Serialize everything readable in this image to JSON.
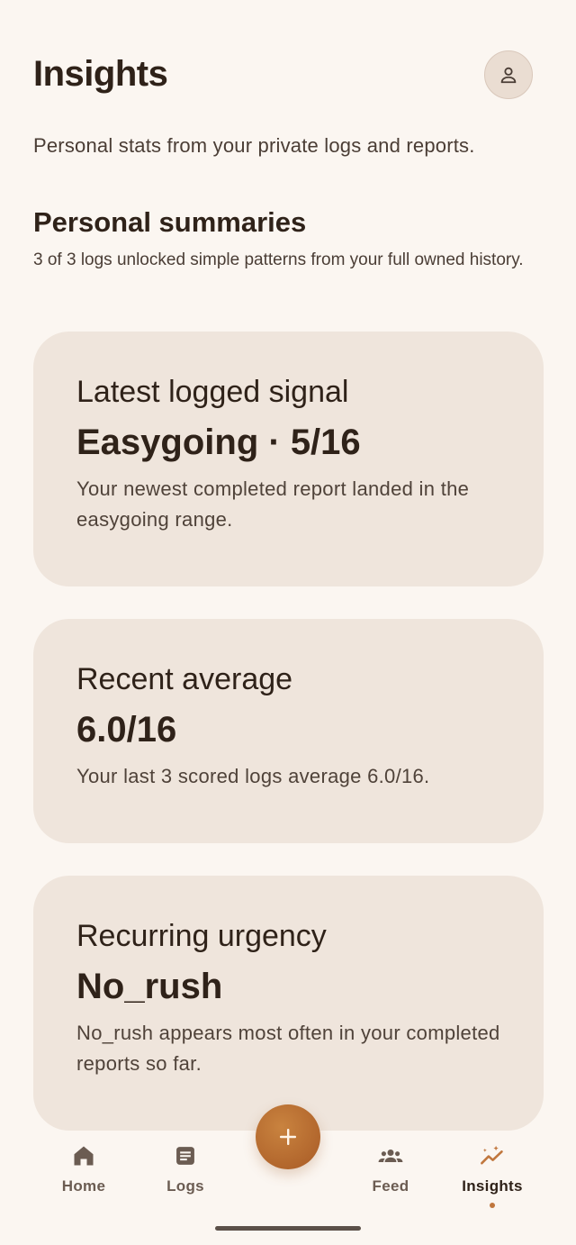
{
  "header": {
    "title": "Insights",
    "avatar_icon": "person-icon"
  },
  "subtitle": "Personal stats from your private logs and reports.",
  "section": {
    "title": "Personal summaries",
    "description": "3 of 3 logs unlocked simple patterns from your full owned history."
  },
  "cards": [
    {
      "label": "Latest logged signal",
      "value": "Easygoing · 5/16",
      "description": "Your newest completed report landed in the easygoing range."
    },
    {
      "label": "Recent average",
      "value": "6.0/16",
      "description": "Your last 3 scored logs average 6.0/16."
    },
    {
      "label": "Recurring urgency",
      "value": "No_rush",
      "description": "No_rush appears most often in your completed reports so far."
    }
  ],
  "fab": {
    "icon": "plus-icon"
  },
  "nav": [
    {
      "label": "Home",
      "icon": "home-icon"
    },
    {
      "label": "Logs",
      "icon": "document-icon"
    },
    {
      "label": "Feed",
      "icon": "group-icon"
    },
    {
      "label": "Insights",
      "icon": "insights-icon",
      "active": true
    }
  ],
  "colors": {
    "accent": "#c0763d",
    "background": "#fbf6f1",
    "card": "#efe5dc",
    "text": "#2f2219"
  }
}
